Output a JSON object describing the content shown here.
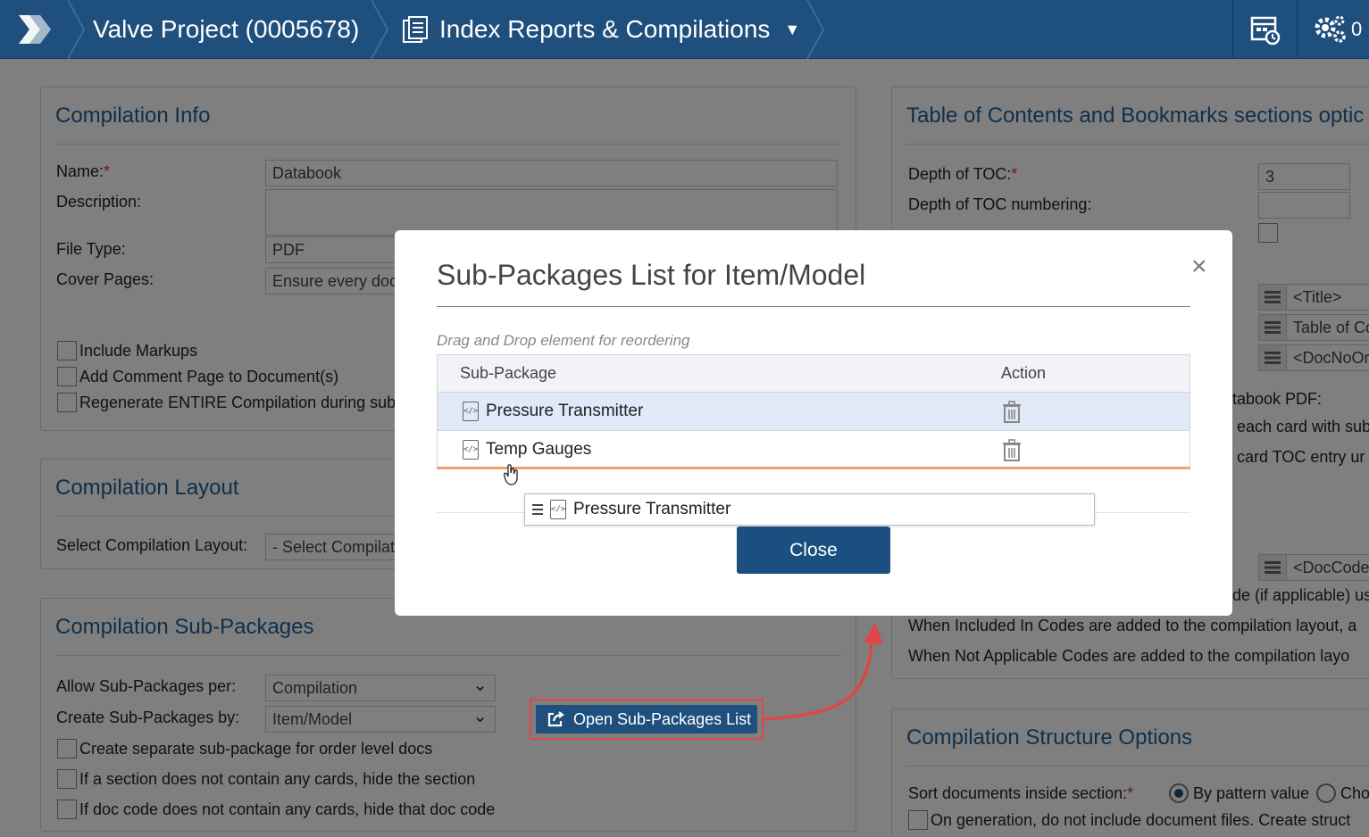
{
  "header": {
    "project_crumb": "Valve Project (0005678)",
    "module_crumb": "Index Reports & Compilations",
    "notif_count": "0"
  },
  "compilation_info": {
    "title": "Compilation Info",
    "name_label": "Name:",
    "name_value": "Databook",
    "description_label": "Description:",
    "description_value": "",
    "file_type_label": "File Type:",
    "file_type_value": "PDF",
    "cover_pages_label": "Cover Pages:",
    "cover_pages_value": "Ensure every doc",
    "include_markups": "Include Markups",
    "add_comment_page": "Add Comment Page to Document(s)",
    "regenerate": "Regenerate ENTIRE Compilation during sub"
  },
  "compilation_layout": {
    "title": "Compilation Layout",
    "select_label": "Select Compilation Layout:",
    "select_value": "- Select Compilat"
  },
  "sub_packages": {
    "title": "Compilation Sub-Packages",
    "allow_label": "Allow Sub-Packages per:",
    "allow_value": "Compilation",
    "create_by_label": "Create Sub-Packages by:",
    "create_by_value": "Item/Model",
    "open_button": "Open Sub-Packages List",
    "separate_order": "Create separate sub-package for order level docs",
    "hide_section": "If a section does not contain any cards, hide the section",
    "hide_doc_code": "If doc code does not contain any cards, hide that doc code"
  },
  "toc": {
    "title": "Table of Contents and Bookmarks sections optic",
    "depth_label": "Depth of TOC:",
    "depth_value": "3",
    "numbering_label": "Depth of TOC numbering:",
    "numbering_value": "",
    "title_token": "<Title>",
    "toc_token": "Table of Co",
    "docno_token": "<DocNoOr",
    "databook_text": "tabook PDF:",
    "each_card_text": "each card with sub",
    "card_toc_text": "card TOC entry ur",
    "doccode_token": "<DocCode",
    "applicable_text": "de (if applicable) us",
    "included_codes_text": "When Included In Codes are added to the compilation layout, a",
    "not_applicable_text": "When Not Applicable Codes are added to the compilation layo"
  },
  "structure": {
    "title": "Compilation Structure Options",
    "sort_label": "Sort documents inside section:",
    "by_pattern": "By pattern value",
    "other_option": "Cho",
    "no_doc_files": "On generation, do not include document files. Create struct"
  },
  "modal": {
    "title": "Sub-Packages List for Item/Model",
    "hint": "Drag and Drop element for reordering",
    "col_sub_package": "Sub-Package",
    "col_action": "Action",
    "rows": [
      {
        "name": "Pressure Transmitter"
      },
      {
        "name": "Temp Gauges"
      }
    ],
    "drag_ghost": "Pressure Transmitter",
    "close_button": "Close"
  },
  "colors": {
    "header_bg": "#1f4f7d",
    "accent_title": "#1f5f96",
    "highlight_red": "#e04646",
    "selected_row": "#dfe9f8"
  }
}
